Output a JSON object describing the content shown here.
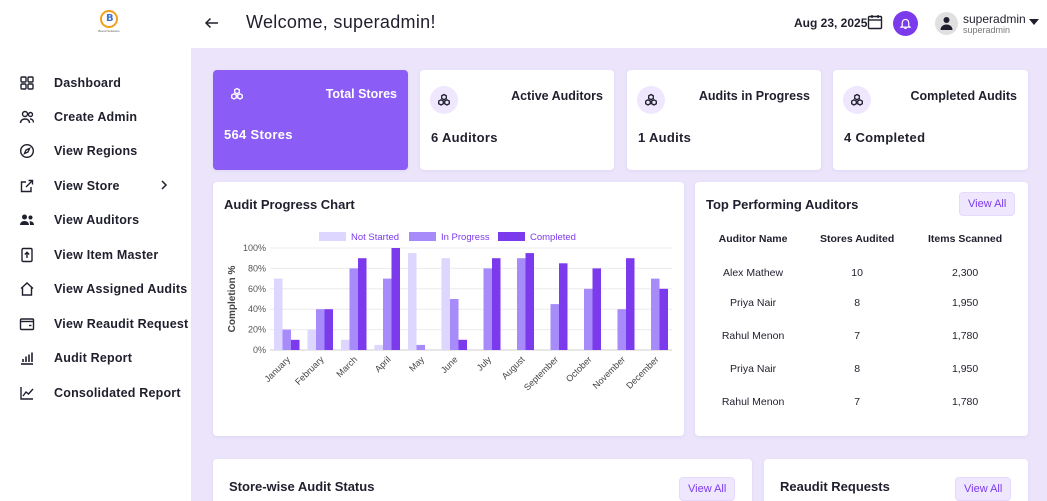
{
  "logo": {
    "letter": "B",
    "caption": "Brand Solutions"
  },
  "sidebar": {
    "items": [
      {
        "label": "Dashboard",
        "icon": "grid-icon"
      },
      {
        "label": "Create Admin",
        "icon": "users-icon"
      },
      {
        "label": "View Regions",
        "icon": "compass-icon"
      },
      {
        "label": "View Store",
        "icon": "external-link-icon"
      },
      {
        "label": "View Auditors",
        "icon": "people-icon"
      },
      {
        "label": "View Item Master",
        "icon": "file-upload-icon"
      },
      {
        "label": "View Assigned Audits",
        "icon": "home-icon"
      },
      {
        "label": "View Reaudit Request",
        "icon": "wallet-icon"
      },
      {
        "label": "Audit Report",
        "icon": "bar-chart-icon"
      },
      {
        "label": "Consolidated Report",
        "icon": "line-chart-icon"
      }
    ]
  },
  "header": {
    "welcome": "Welcome, superadmin!",
    "date": "Aug 23, 2025",
    "user_name": "superadmin",
    "user_role": "superadmin"
  },
  "stats": [
    {
      "title": "Total Stores",
      "value": "564 Stores",
      "icon": "cubes-icon",
      "active": true
    },
    {
      "title": "Active Auditors",
      "value": "6 Auditors",
      "icon": "cubes-icon",
      "active": false
    },
    {
      "title": "Audits in Progress",
      "value": "1 Audits",
      "icon": "cubes-icon",
      "active": false
    },
    {
      "title": "Completed Audits",
      "value": "4 Completed",
      "icon": "cubes-icon",
      "active": false
    }
  ],
  "colors": {
    "accent": "#7c3aed",
    "not_started": "#ddd6fe",
    "in_progress": "#a78bfa",
    "completed": "#7c3aed"
  },
  "chart_panel": {
    "title": "Audit Progress Chart"
  },
  "chart_data": {
    "type": "bar",
    "title": "",
    "xlabel": "",
    "ylabel": "Completion %",
    "ylim": [
      0,
      100
    ],
    "yticks": [
      "0%",
      "20%",
      "40%",
      "60%",
      "80%",
      "100%"
    ],
    "grid": true,
    "legend": "top-center",
    "categories": [
      "January",
      "February",
      "March",
      "April",
      "May",
      "June",
      "July",
      "August",
      "September",
      "October",
      "November",
      "December"
    ],
    "series": [
      {
        "name": "Not Started",
        "values": [
          70,
          20,
          10,
          5,
          95,
          90,
          0,
          0,
          0,
          0,
          0,
          0
        ]
      },
      {
        "name": "In Progress",
        "values": [
          20,
          40,
          80,
          70,
          5,
          50,
          80,
          90,
          45,
          60,
          40,
          70
        ]
      },
      {
        "name": "Completed",
        "values": [
          10,
          40,
          90,
          100,
          0,
          10,
          90,
          95,
          85,
          80,
          90,
          60
        ]
      }
    ]
  },
  "top_auditors": {
    "title": "Top Performing Auditors",
    "view_all": "View All",
    "columns": [
      "Auditor Name",
      "Stores Audited",
      "Items Scanned"
    ],
    "rows": [
      [
        "Alex Mathew",
        "10",
        "2,300"
      ],
      [
        "Priya Nair",
        "8",
        "1,950"
      ],
      [
        "Rahul Menon",
        "7",
        "1,780"
      ],
      [
        "Priya Nair",
        "8",
        "1,950"
      ],
      [
        "Rahul Menon",
        "7",
        "1,780"
      ]
    ]
  },
  "store_status": {
    "title": "Store-wise Audit Status",
    "view_all": "View All"
  },
  "reaudit": {
    "title": "Reaudit Requests",
    "view_all": "View All"
  }
}
